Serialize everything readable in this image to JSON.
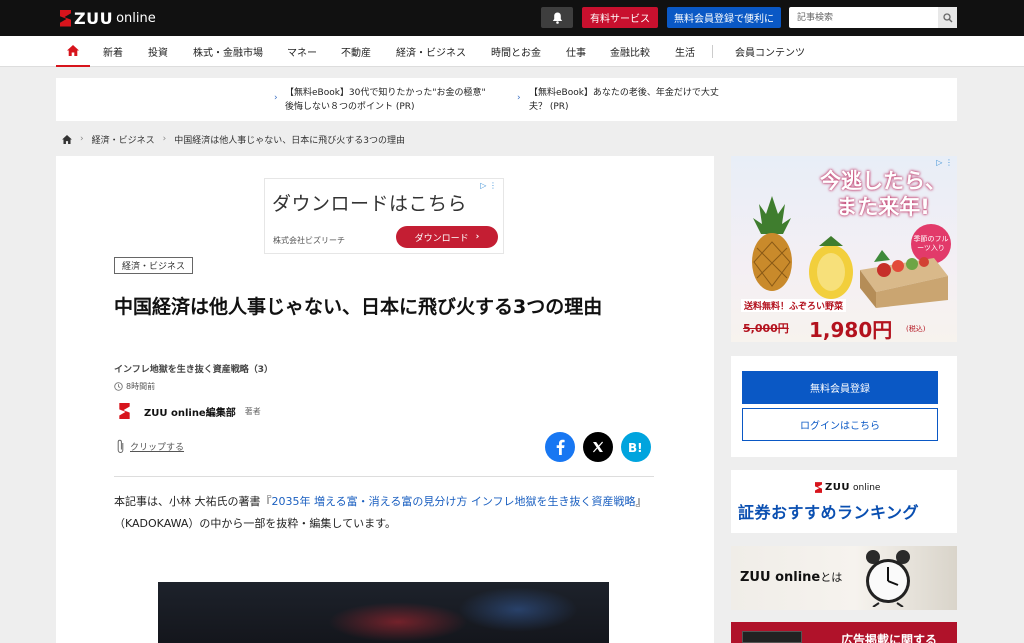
{
  "header": {
    "logo_zuu": "ZUU",
    "logo_online": "online",
    "paid_service": "有料サービス",
    "free_signup": "無料会員登録で便利に",
    "search_placeholder": "記事検索"
  },
  "nav": {
    "items": [
      "新着",
      "投資",
      "株式・金融市場",
      "マネー",
      "不動産",
      "経済・ビジネス",
      "時間とお金",
      "仕事",
      "金融比較",
      "生活",
      "会員コンテンツ"
    ]
  },
  "promo": {
    "links": [
      {
        "line1": "【無料eBook】30代で知りたかった\"お金の極意\"",
        "line2": "後悔しない８つのポイント (PR)"
      },
      {
        "line1": "【無料eBook】あなたの老後、年金だけで大丈",
        "line2": "夫？ (PR)"
      }
    ]
  },
  "breadcrumb": {
    "items": [
      "経済・ビジネス",
      "中国経済は他人事じゃない、日本に飛び火する3つの理由"
    ]
  },
  "ad_top": {
    "title": "ダウンロードはこちら",
    "company": "株式会社ビズリーチ",
    "button": "ダウンロード"
  },
  "article": {
    "category": "経済・ビジネス",
    "title": "中国経済は他人事じゃない、日本に飛び火する3つの理由",
    "subtitle": "インフレ地獄を生き抜く資産戦略（3）",
    "time": "8時間前",
    "author": "ZUU online編集部",
    "author_role": "著者",
    "clip": "クリップする",
    "body_prefix": "本記事は、小林 大祐氏の著書『",
    "body_link": "2035年 増える富・消える富の見分け方 インフレ地獄を生き抜く資産戦略",
    "body_suffix": "』（KADOKAWA）の中から一部を抜粋・編集しています。"
  },
  "sidebar": {
    "ad_headline_1": "今逃したら、",
    "ad_headline_2": "また来年!",
    "ad_badge": "季節のフルーツ入り",
    "ad_shipping": "送料無料！ふぞろい野菜",
    "ad_old_price": "5,000円",
    "ad_new_price": "1,980円",
    "ad_tax": "(税込)",
    "member_button": "無料会員登録",
    "login_button": "ログインはこちら",
    "ranking_title": "証券おすすめランキング",
    "about_name": "ZUU online",
    "about_suffix": "とは",
    "bottom_banner": "広告掲載に関する"
  },
  "colors": {
    "brand_red": "#d7141c",
    "brand_blue": "#0a58c5",
    "header_bg": "#111111"
  }
}
